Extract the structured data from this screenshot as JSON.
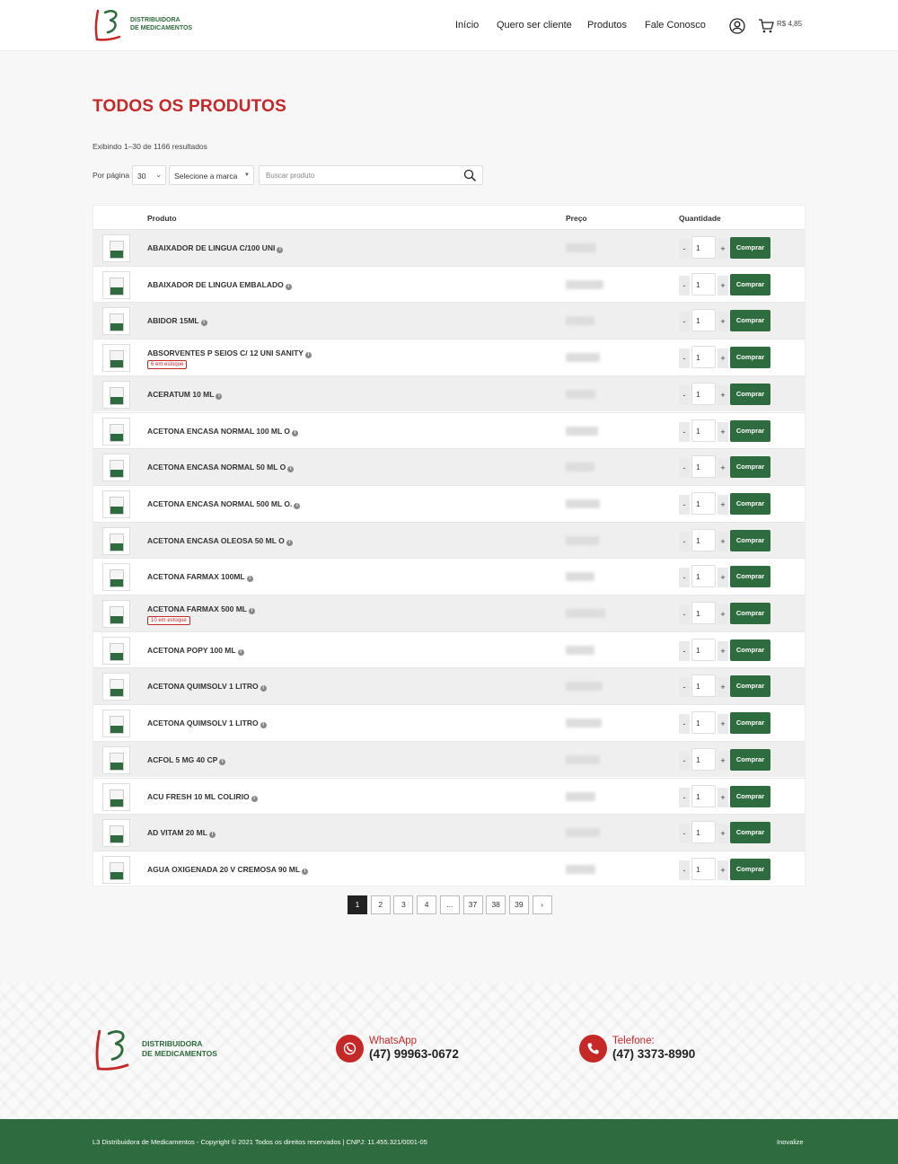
{
  "brand": {
    "logo_text": "DISTRIBUIDORA\nDE MEDICAMENTOS",
    "accent": "#2e6b3e",
    "red": "#c62828"
  },
  "nav": {
    "items": [
      "Início",
      "Quero ser cliente",
      "Produtos",
      "Fale Conosco"
    ],
    "cart_total": "R$ 4,85"
  },
  "page": {
    "title": "TODOS OS PRODUTOS",
    "results": "Exibindo 1–30 de 1166 resultados"
  },
  "filters": {
    "per_page_label": "Por página",
    "per_page_value": "30",
    "brand_select": "Selecione a marca",
    "search_placeholder": "Buscar produto"
  },
  "table": {
    "headers": {
      "product": "Produto",
      "price": "Preço",
      "quantity": "Quantidade"
    },
    "buy_label": "Comprar",
    "rows": [
      {
        "name": "ABAIXADOR DE LINGUA C/100 UNI",
        "qty": "1",
        "stock": ""
      },
      {
        "name": "ABAIXADOR DE LINGUA EMBALADO",
        "qty": "1",
        "stock": ""
      },
      {
        "name": "ABIDOR 15ML",
        "qty": "1",
        "stock": ""
      },
      {
        "name": "ABSORVENTES P SEIOS C/ 12 UNI SANITY",
        "qty": "1",
        "stock": "6 em estoque"
      },
      {
        "name": "ACERATUM 10 ML",
        "qty": "1",
        "stock": ""
      },
      {
        "name": "ACETONA ENCASA NORMAL 100 ML O",
        "qty": "1",
        "stock": ""
      },
      {
        "name": "ACETONA ENCASA NORMAL 50 ML O",
        "qty": "1",
        "stock": ""
      },
      {
        "name": "ACETONA ENCASA NORMAL 500 ML O.",
        "qty": "1",
        "stock": ""
      },
      {
        "name": "ACETONA ENCASA OLEOSA 50 ML O",
        "qty": "1",
        "stock": ""
      },
      {
        "name": "ACETONA FARMAX 100ML",
        "qty": "1",
        "stock": ""
      },
      {
        "name": "ACETONA FARMAX 500 ML",
        "qty": "1",
        "stock": "10 em estoque"
      },
      {
        "name": "ACETONA POPY 100 ML",
        "qty": "1",
        "stock": ""
      },
      {
        "name": "ACETONA QUIMSOLV 1 LITRO",
        "qty": "1",
        "stock": ""
      },
      {
        "name": "ACETONA QUIMSOLV 1 LITRO",
        "qty": "1",
        "stock": ""
      },
      {
        "name": "ACFOL 5 MG 40 CP",
        "qty": "1",
        "stock": ""
      },
      {
        "name": "ACU FRESH 10 ML COLIRIO",
        "qty": "1",
        "stock": ""
      },
      {
        "name": "AD VITAM 20 ML",
        "qty": "1",
        "stock": ""
      },
      {
        "name": "AGUA OXIGENADA 20 V CREMOSA 90 ML",
        "qty": "1",
        "stock": ""
      }
    ]
  },
  "pagination": [
    "1",
    "2",
    "3",
    "4",
    "...",
    "37",
    "38",
    "39",
    "›"
  ],
  "footer": {
    "whatsapp_label": "WhatsApp",
    "whatsapp_number": "(47) 99963-0672",
    "phone_label": "Telefone:",
    "phone_number": "(47) 3373-8990",
    "copyright": "L3 Distribuidora de Medicamentos - Copyright © 2021 Todos os direitos reservados | CNPJ: 11.455.321/0001-05",
    "credit": "Inovalize"
  }
}
